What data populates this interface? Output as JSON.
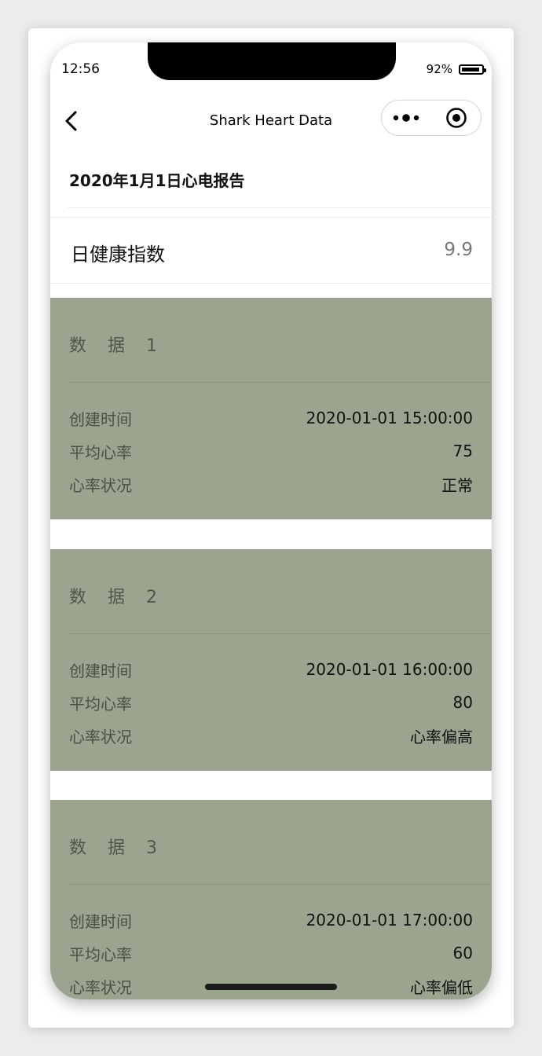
{
  "status_bar": {
    "time": "12:56",
    "battery": "92%",
    "battery_level": 0.92
  },
  "navbar": {
    "title": "Shark Heart Data"
  },
  "report": {
    "title": "2020年1月1日心电报告"
  },
  "health": {
    "label": "日健康指数",
    "value": "9.9"
  },
  "records": [
    {
      "title": "数 据 1",
      "rows": [
        {
          "label": "创建时间",
          "value": "2020-01-01 15:00:00"
        },
        {
          "label": "平均心率",
          "value": "75"
        },
        {
          "label": "心率状况",
          "value": "正常"
        }
      ]
    },
    {
      "title": "数 据 2",
      "rows": [
        {
          "label": "创建时间",
          "value": "2020-01-01 16:00:00"
        },
        {
          "label": "平均心率",
          "value": "80"
        },
        {
          "label": "心率状况",
          "value": "心率偏高"
        }
      ]
    },
    {
      "title": "数 据 3",
      "rows": [
        {
          "label": "创建时间",
          "value": "2020-01-01 17:00:00"
        },
        {
          "label": "平均心率",
          "value": "60"
        },
        {
          "label": "心率状况",
          "value": "心率偏低"
        }
      ]
    }
  ],
  "colors": {
    "card_background": "#9aa48f",
    "card_label_text": "#4a5046",
    "health_value_text": "#777777"
  }
}
